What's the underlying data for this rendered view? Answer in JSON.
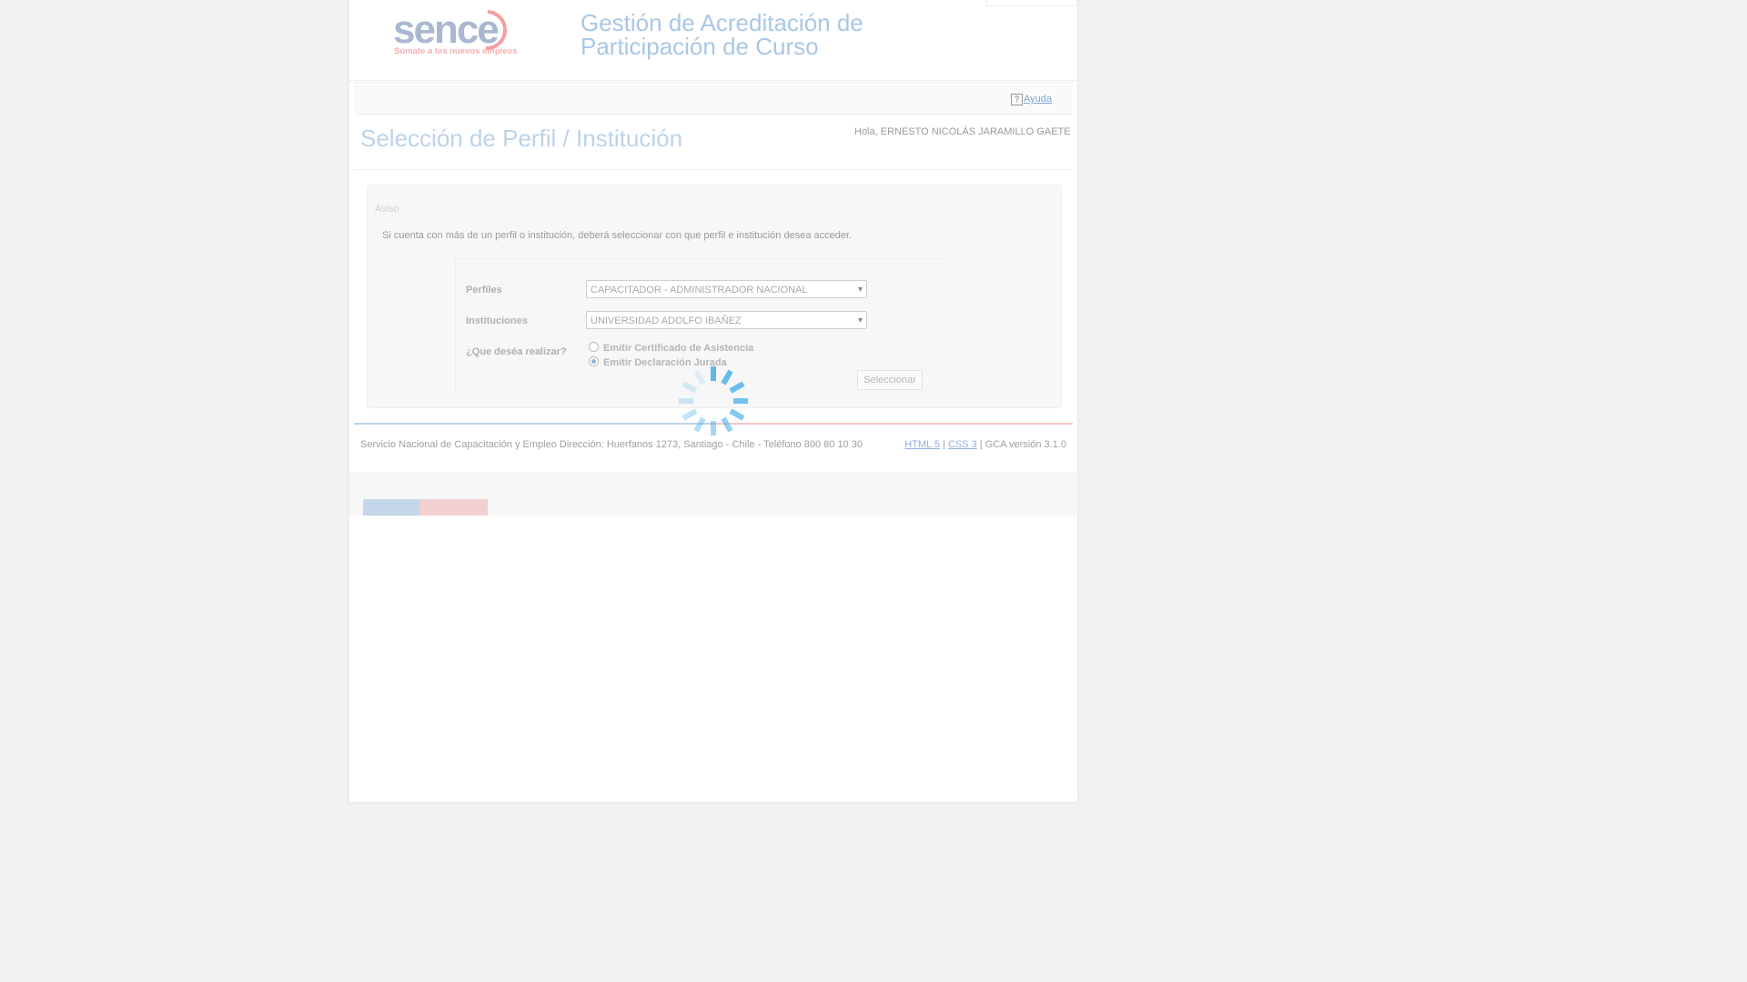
{
  "header": {
    "logo_text": "sence",
    "logo_tagline": "Súmate a los nuevos empleos",
    "app_title": "Gestión de Acreditación de Participación de Curso"
  },
  "nav": {
    "help_label": "Ayuda"
  },
  "page": {
    "title": "Selección de Perfil / Institución",
    "greeting": "Hola, ERNESTO NICOLÁS JARAMILLO GAETE"
  },
  "panel": {
    "legend": "Aviso",
    "message": "Si cuenta con más de un perfil o institución, deberá seleccionar con que perfil e institución desea acceder."
  },
  "form": {
    "profiles_label": "Perfiles",
    "profiles_value": "CAPACITADOR - ADMINISTRADOR NACIONAL",
    "institutions_label": "Instituciones",
    "institutions_value": "UNIVERSIDAD ADOLFO IBAÑEZ",
    "action_label": "¿Que deséa realizar?",
    "option_1": "Emitir Certificado de Asistencia",
    "option_2": "Emitir Declaración Jurada",
    "selected_option": "option_2",
    "submit_label": "Seleccionar"
  },
  "footer": {
    "address": "Servicio Nacional de Capacitación y Empleo Dirección: Huerfanos 1273, Santiago - Chile - Teléfono 800 80 10 30",
    "html5_link": "HTML 5",
    "css3_link": "CSS 3",
    "separator": "|",
    "version": "GCA versión 3.1.0"
  },
  "colors": {
    "brand_blue": "#a9c7e6",
    "brand_red": "#f08080",
    "spinner_blue": "#5bb8ea"
  },
  "icons": {
    "help": "help-icon",
    "loading": "loading-spinner-icon",
    "select_caret": "chevron-down-icon"
  }
}
